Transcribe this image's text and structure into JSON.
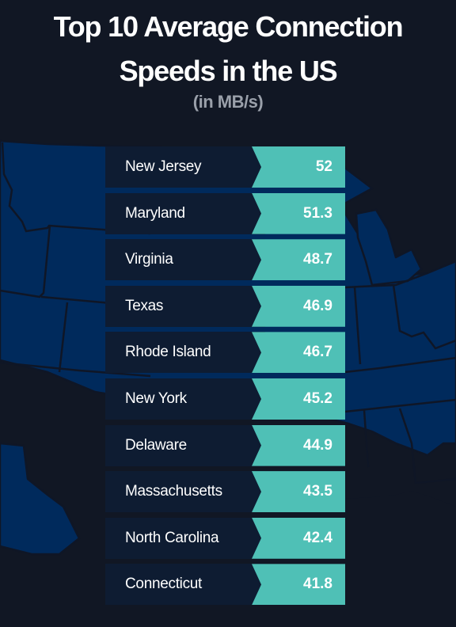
{
  "header": {
    "title_line1": "Top 10 Average Connection",
    "title_line2": "Speeds in the US",
    "subtitle": "(in MB/s)"
  },
  "colors": {
    "background": "#111724",
    "map_fill": "#002a5c",
    "state_cell": "#0e1c32",
    "value_cell": "#4fc0b6",
    "text": "#ffffff",
    "subtitle": "#9aa0aa"
  },
  "chart_data": {
    "type": "table",
    "title": "Top 10 Average Connection Speeds in the US",
    "subtitle": "(in MB/s)",
    "unit": "MB/s",
    "categories": [
      "New Jersey",
      "Maryland",
      "Virginia",
      "Texas",
      "Rhode Island",
      "New York",
      "Delaware",
      "Massachusetts",
      "North Carolina",
      "Connecticut"
    ],
    "values": [
      52,
      51.3,
      48.7,
      46.9,
      46.7,
      45.2,
      44.9,
      43.5,
      42.4,
      41.8
    ],
    "rows": [
      {
        "state": "New Jersey",
        "value": "52"
      },
      {
        "state": "Maryland",
        "value": "51.3"
      },
      {
        "state": "Virginia",
        "value": "48.7"
      },
      {
        "state": "Texas",
        "value": "46.9"
      },
      {
        "state": "Rhode Island",
        "value": "46.7"
      },
      {
        "state": "New York",
        "value": "45.2"
      },
      {
        "state": "Delaware",
        "value": "44.9"
      },
      {
        "state": "Massachusetts",
        "value": "43.5"
      },
      {
        "state": "North Carolina",
        "value": "42.4"
      },
      {
        "state": "Connecticut",
        "value": "41.8"
      }
    ]
  }
}
